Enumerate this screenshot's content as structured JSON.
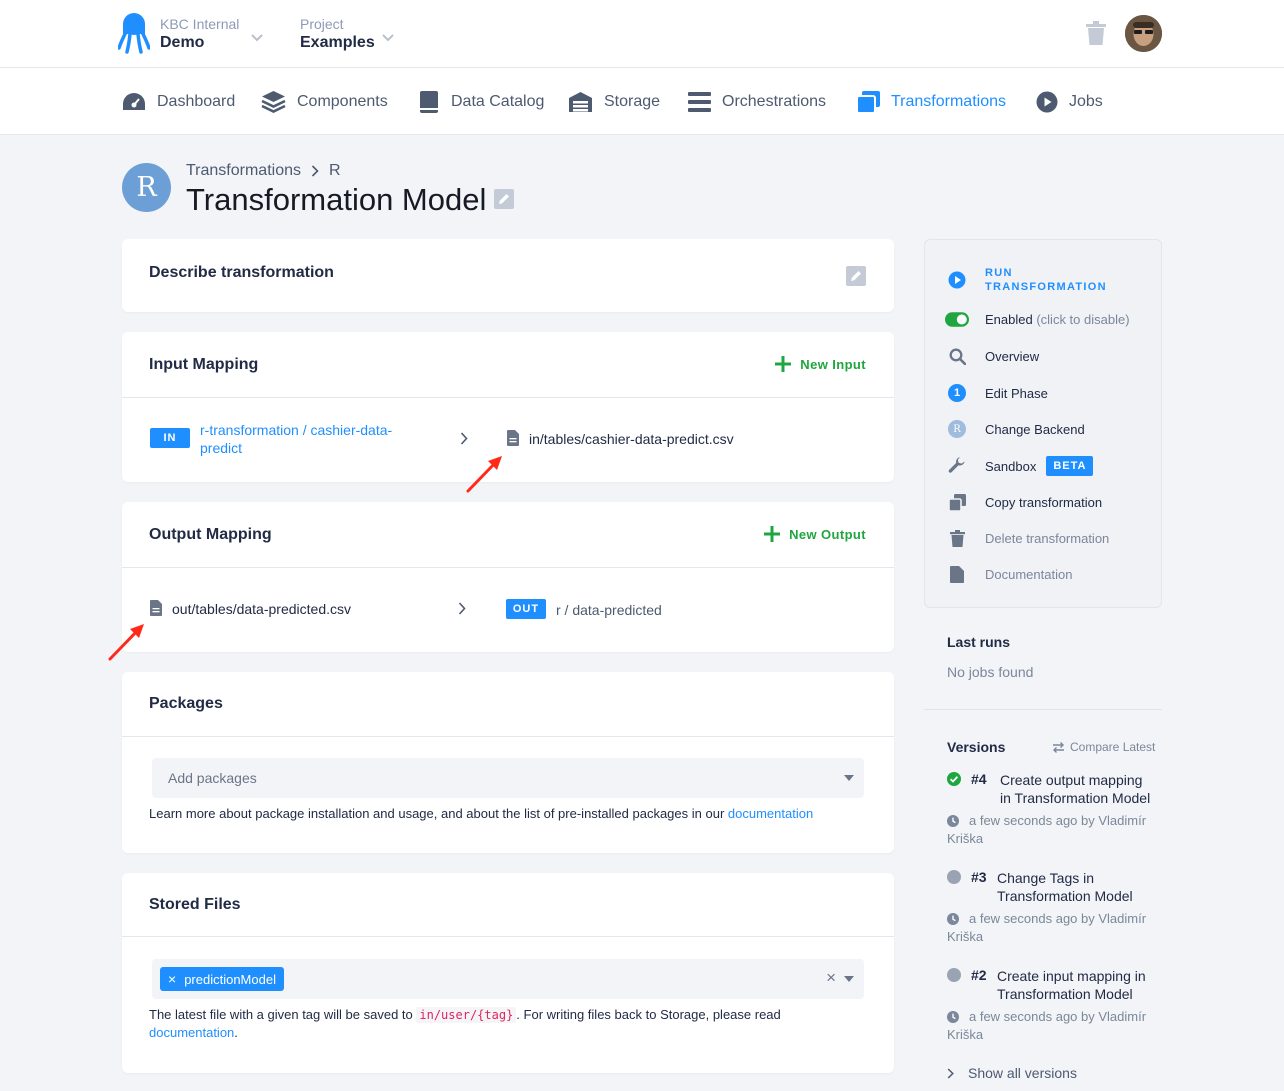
{
  "header": {
    "org_label": "KBC Internal",
    "org_name": "Demo",
    "project_label": "Project",
    "project_name": "Examples"
  },
  "nav": [
    {
      "label": "Dashboard",
      "icon": "dashboard-icon"
    },
    {
      "label": "Components",
      "icon": "layers-icon"
    },
    {
      "label": "Data Catalog",
      "icon": "book-icon"
    },
    {
      "label": "Storage",
      "icon": "warehouse-icon"
    },
    {
      "label": "Orchestrations",
      "icon": "bars-icon"
    },
    {
      "label": "Transformations",
      "icon": "window-icon",
      "active": true
    },
    {
      "label": "Jobs",
      "icon": "play-circle-icon"
    }
  ],
  "page": {
    "backend_letter": "R",
    "breadcrumb": [
      "Transformations",
      "R"
    ],
    "title": "Transformation Model"
  },
  "describe": {
    "title": "Describe transformation"
  },
  "input_mapping": {
    "title": "Input Mapping",
    "add_label": "New Input",
    "row": {
      "tag": "IN",
      "source_line1": "r-transformation / cashier-data-",
      "source_line2": "predict",
      "destination": "in/tables/cashier-data-predict.csv"
    }
  },
  "output_mapping": {
    "title": "Output Mapping",
    "add_label": "New Output",
    "row": {
      "source": "out/tables/data-predicted.csv",
      "tag": "OUT",
      "destination": "r / data-predicted"
    }
  },
  "packages": {
    "title": "Packages",
    "placeholder": "Add packages",
    "help_text": "Learn more about package installation and usage, and about the list of pre-installed packages in our ",
    "help_link": "documentation"
  },
  "stored_files": {
    "title": "Stored Files",
    "selected_tag": "predictionModel",
    "help_part1": "The latest file with a given tag will be saved to ",
    "help_code": "in/user/{tag}",
    "help_part2": ". For writing files back to Storage, please read",
    "help_link": "documentation",
    "help_end": "."
  },
  "sidebar": {
    "run_line1": "RUN",
    "run_line2": "TRANSFORMATION",
    "enabled_label": "Enabled",
    "enabled_hint": "(click to disable)",
    "enabled": true,
    "overview": "Overview",
    "edit_phase_number": "1",
    "edit_phase": "Edit Phase",
    "change_backend": "Change Backend",
    "sandbox": "Sandbox",
    "sandbox_badge": "BETA",
    "copy": "Copy transformation",
    "delete": "Delete transformation",
    "documentation": "Documentation"
  },
  "last_runs": {
    "title": "Last runs",
    "empty": "No jobs found"
  },
  "versions": {
    "title": "Versions",
    "compare_label": "Compare Latest",
    "items": [
      {
        "number": "#4",
        "line1": "Create output mapping",
        "line2": "in Transformation Model",
        "meta1": "a few seconds ago by Vladimír",
        "meta2": "Kriška",
        "status": "current",
        "color": "#20a640"
      },
      {
        "number": "#3",
        "line1": "Change Tags in",
        "line2": "Transformation Model",
        "meta1": "a few seconds ago by Vladimír",
        "meta2": "Kriška",
        "status": "old",
        "color": "#9aa3b2"
      },
      {
        "number": "#2",
        "line1": "Create input mapping in",
        "line2": "Transformation Model",
        "meta1": "a few seconds ago by Vladimír",
        "meta2": "Kriška",
        "status": "old",
        "color": "#9aa3b2"
      }
    ],
    "show_all": "Show all versions"
  },
  "colors": {
    "accent": "#1f8fff",
    "success": "#20a640",
    "annotation_arrow": "#ff2a1a"
  }
}
